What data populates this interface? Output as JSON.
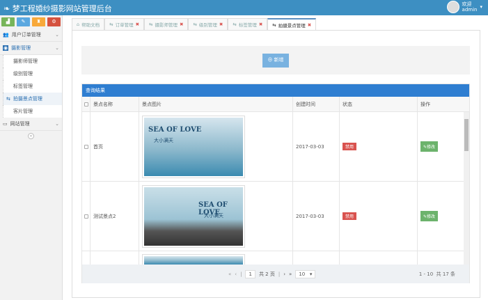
{
  "header": {
    "title": "梦工程婚纱摄影网站管理后台",
    "welcome": "欢迎",
    "username": "admin"
  },
  "sidebar": {
    "shortcuts": [
      "▟",
      "✎",
      "♜",
      "⚙"
    ],
    "items": [
      {
        "label": "用户订单管理",
        "icon": "users-icon"
      },
      {
        "label": "摄影管理",
        "icon": "camera-icon"
      },
      {
        "label": "网站管理",
        "icon": "monitor-icon"
      }
    ],
    "subitems": [
      "摄影师管理",
      "级别管理",
      "标签管理",
      "拍摄景点管理",
      "客片管理"
    ]
  },
  "tabs": [
    {
      "label": "帮助文档"
    },
    {
      "label": "订单管理"
    },
    {
      "label": "摄影师管理"
    },
    {
      "label": "级别管理"
    },
    {
      "label": "标签管理"
    },
    {
      "label": "拍摄景点管理"
    }
  ],
  "toolbar": {
    "add_label": "新增"
  },
  "result": {
    "title": "查询结果",
    "columns": [
      "景点名称",
      "景点图片",
      "创建时间",
      "状态",
      "操作"
    ],
    "rows": [
      {
        "name": "首页",
        "image_text": "SEA OF LOVE",
        "image_sub": "大小满天",
        "created": "2017-03-03",
        "status": "禁用",
        "action": "修改"
      },
      {
        "name": "测试景点2",
        "image_text": "SEA OF LOVE",
        "image_sub": "大小满天",
        "created": "2017-03-03",
        "status": "禁用",
        "action": "修改"
      }
    ]
  },
  "pager": {
    "page": "1",
    "total_pages": "共 2 页",
    "page_size": "10",
    "range": "1 - 10",
    "total": "共 17 条"
  },
  "colors": {
    "header": "#3d8fc2",
    "result_header": "#2f7ed1",
    "status_disabled": "#d9534f",
    "edit": "#6cb36c"
  }
}
